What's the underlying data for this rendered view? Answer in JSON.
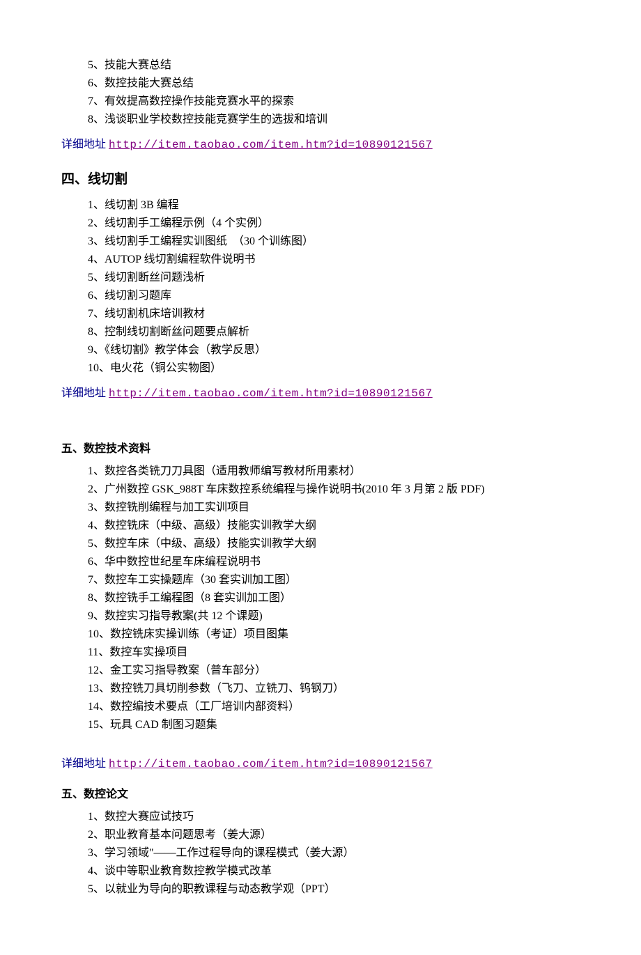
{
  "topList": [
    "5、技能大赛总结",
    "6、数控技能大赛总结",
    "7、有效提高数控操作技能竞赛水平的探索",
    "8、浅谈职业学校数控技能竞赛学生的选拔和培训"
  ],
  "linkLabel": "详细地址",
  "linkUrl": "http://item.taobao.com/item.htm?id=10890121567",
  "section4": {
    "heading": "四、线切割",
    "items": [
      "1、线切割 3B 编程",
      "2、线切割手工编程示例（4 个实例）",
      "3、线切割手工编程实训图纸　（30 个训练图）",
      "4、AUTOP 线切割编程软件说明书",
      "5、线切割断丝问题浅析",
      "6、线切割习题库",
      "7、线切割机床培训教材",
      "8、控制线切割断丝问题要点解析",
      "9、《线切割》教学体会（教学反思）",
      "10、电火花（铜公实物图）"
    ]
  },
  "section5a": {
    "heading": "五、数控技术资料",
    "items": [
      "1、数控各类铣刀刀具图（适用教师编写教材所用素材）",
      "2、广州数控 GSK_988T 车床数控系统编程与操作说明书(2010 年 3 月第 2 版 PDF)",
      "3、数控铣削编程与加工实训项目",
      "4、数控铣床（中级、高级）技能实训教学大纲",
      "5、数控车床（中级、高级）技能实训教学大纲",
      "6、华中数控世纪星车床编程说明书",
      "7、数控车工实操题库（30 套实训加工图）",
      "8、数控铣手工编程图（8 套实训加工图）",
      "9、数控实习指导教案(共 12 个课题)",
      "10、数控铣床实操训练（考证）项目图集",
      "11、数控车实操项目",
      "12、金工实习指导教案（普车部分）",
      "13、数控铣刀具切削参数（飞刀、立铣刀、钨钢刀）",
      "14、数控编技术要点（工厂培训内部资料）",
      "15、玩具 CAD 制图习题集"
    ]
  },
  "section5b": {
    "heading": "五、数控论文",
    "items": [
      "1、数控大赛应试技巧",
      "2、职业教育基本问题思考（姜大源）",
      "3、学习领域\"——工作过程导向的课程模式（姜大源）",
      "4、谈中等职业教育数控教学模式改革",
      "5、以就业为导向的职教课程与动态教学观（PPT）"
    ]
  }
}
